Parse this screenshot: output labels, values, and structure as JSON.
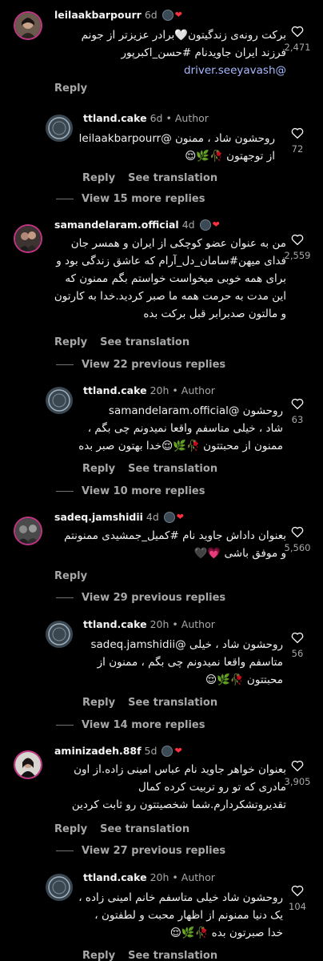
{
  "comments": [
    {
      "username": "leilaakbarpourr",
      "time": "6d",
      "lines": [
        "برکت رونه‌ی زندگیتون🤍برادر عزیزتر از جونم",
        "فرزند ایران جاویدنام #حسن_اکبرپور",
        "@driver.seeyavash"
      ],
      "likes": "2,471",
      "reply": "Reply"
    },
    {
      "username": "ttland.cake",
      "time": "6d",
      "author": "Author",
      "lines": [
        "روحشون شاد ، ممنون @leilaakbarpourr",
        "از توجهتون 🥀🌿😌"
      ],
      "likes": "72",
      "reply": "Reply",
      "translate": "See translation"
    },
    {
      "more": "View 15 more replies"
    },
    {
      "username": "samandelaram.official",
      "time": "4d",
      "lines": [
        "من به عنوان عضو کوچکی از ایران و همسر جان",
        "فدای میهن#سامان_دل_آرام که عاشق زندگی بود و",
        "برای همه خوبی میخواست خواستم بگم ممنون که",
        "این مدت به حرمت همه ما صبر کردید.خدا به کارتون",
        "و مالتون صدبرابر قبل برکت بده"
      ],
      "likes": "2,559",
      "reply": "Reply",
      "translate": "See translation"
    },
    {
      "more": "View 22 previous replies"
    },
    {
      "username": "ttland.cake",
      "time": "20h",
      "author": "Author",
      "lines": [
        "روحشون @samandelaram.official",
        "شاد ، خیلی متاسفم واقعا نمیدونم چی بگم ،",
        "ممنون از محبتتون 🥀🌿😌خدا بهتون صبر بده"
      ],
      "likes": "63",
      "reply": "Reply",
      "translate": "See translation"
    },
    {
      "more": "View 10 more replies"
    },
    {
      "username": "sadeq.jamshidii",
      "time": "4d",
      "lines": [
        "بعنوان داداش جاوید نام #کمیل_جمشیدی ممنونتم",
        "و موفق باشی 💗🖤"
      ],
      "likes": "5,560",
      "reply": "Reply"
    },
    {
      "more": "View 29 previous replies"
    },
    {
      "username": "ttland.cake",
      "time": "20h",
      "author": "Author",
      "lines": [
        "روحشون شاد ، خیلی @sadeq.jamshidii",
        "متاسفم واقعا نمیدونم چی بگم ، ممنون از",
        "محبتتون 🥀🌿😌"
      ],
      "likes": "56",
      "reply": "Reply",
      "translate": "See translation"
    },
    {
      "more": "View 14 more replies"
    },
    {
      "username": "aminizadeh.88f",
      "time": "5d",
      "lines": [
        "بعنوان خواهر جاوید نام عباس امینی زاده.از اون",
        "مادری که تو رو تربیت کرده کمال",
        "تقدیروتشکردارم.شما شخصیتتون رو ثابت کردین"
      ],
      "likes": "3,905",
      "reply": "Reply",
      "translate": "See translation"
    },
    {
      "more": "View 27 previous replies"
    },
    {
      "username": "ttland.cake",
      "time": "20h",
      "author": "Author",
      "lines": [
        "روحشون شاد خیلی متاسفم خانم امینی زاده ،",
        "یک دنیا ممنونم از اظهار محبت و لطفتون ،",
        "خدا صبرتون بده 🥀🌿😌"
      ],
      "likes": "104",
      "reply": "Reply",
      "translate": "See translation"
    }
  ],
  "colors": {
    "background": "#000000",
    "text": "#f5f5f5",
    "muted": "#a8a8a8",
    "link": "#a6b8ff",
    "heart": "#ff3040",
    "story_ring": "#c13584"
  },
  "icons": {
    "like": "heart-outline-icon",
    "author_badge": "reply-avatar-icon"
  }
}
